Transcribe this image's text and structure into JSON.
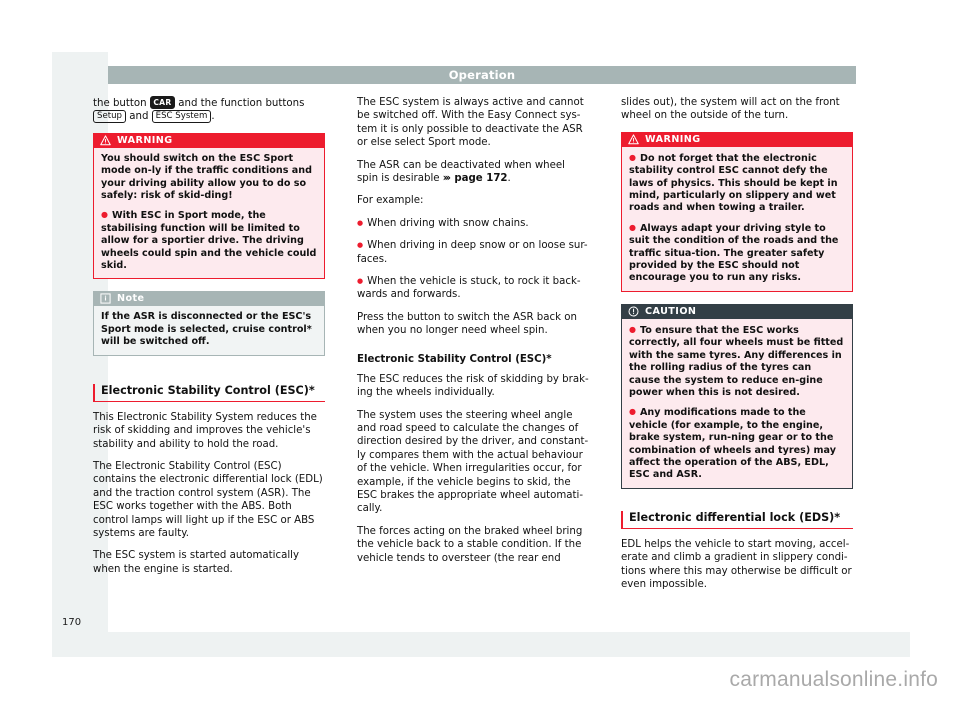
{
  "header": {
    "running_head": "Operation"
  },
  "folio": {
    "page_number": "170"
  },
  "watermark": {
    "text": "carmanualsonline.info"
  },
  "columns": {
    "left": {
      "intro": {
        "lead": "the button ",
        "key_car": "CAR",
        "mid": " and the function buttons ",
        "key_setup": "Setup",
        "and": " and ",
        "key_esc": "ESC System",
        "end": "."
      },
      "warning_box": {
        "title": "WARNING",
        "icon": "warning-triangle-icon",
        "paragraphs": [
          "You should switch on the ESC Sport mode on-ly if the traffic conditions and your driving ability allow you to do so safely: risk of skid-ding!",
          "With ESC in Sport mode, the stabilising function will be limited to allow for a sportier drive. The driving wheels could spin and the vehicle could skid."
        ]
      },
      "note_box": {
        "title": "Note",
        "icon": "info-square-icon",
        "paragraphs": [
          "If the ASR is disconnected or the ESC's Sport mode is selected, cruise control* will be switched off."
        ]
      },
      "section_title": "Electronic Stability Control (ESC)*",
      "paragraphs": [
        "This Electronic Stability System reduces the risk of skidding and improves the vehicle's stability and ability to hold the road.",
        "The Electronic Stability Control (ESC) contains the electronic differential lock (EDL) and the traction control system (ASR). The ESC works together with the ABS. Both control lamps will light up if the ESC or ABS systems are faulty.",
        "The ESC system is started automatically when the engine is started."
      ]
    },
    "middle": {
      "paragraphs_top": [
        "The ESC system is always active and cannot be switched off. With the Easy Connect sys-tem it is only possible to deactivate the ASR or else select Sport mode."
      ],
      "asr_line": {
        "before": "The ASR can be deactivated when wheel spin is desirable ",
        "chevron": "›››",
        "reference": " page 172",
        "after": "."
      },
      "for_example": "For example:",
      "bullets": [
        "When driving with snow chains.",
        "When driving in deep snow or on loose sur-faces.",
        "When the vehicle is stuck, to rock it back-wards and forwards."
      ],
      "press_button": "Press the button to switch the ASR back on when you no longer need wheel spin.",
      "subsection_title": "Electronic Stability Control (ESC)*",
      "paragraphs_bottom": [
        "The ESC reduces the risk of skidding by brak-ing the wheels individually.",
        "The system uses the steering wheel angle and road speed to calculate the changes of direction desired by the driver, and constant-ly compares them with the actual behaviour of the vehicle. When irregularities occur, for example, if the vehicle begins to skid, the ESC brakes the appropriate wheel automati-cally.",
        "The forces acting on the braked wheel bring the vehicle back to a stable condition. If the vehicle tends to oversteer (the rear end"
      ]
    },
    "right": {
      "continuation": "slides out), the system will act on the front wheel on the outside of the turn.",
      "warning_box": {
        "title": "WARNING",
        "icon": "warning-triangle-icon",
        "paragraphs": [
          "Do not forget that the electronic stability control ESC cannot defy the laws of physics. This should be kept in mind, particularly on slippery and wet roads and when towing a trailer.",
          "Always adapt your driving style to suit the condition of the roads and the traffic situa-tion. The greater safety provided by the ESC should not encourage you to run any risks."
        ]
      },
      "caution_box": {
        "title": "CAUTION",
        "icon": "exclamation-circle-icon",
        "paragraphs": [
          "To ensure that the ESC works correctly, all four wheels must be fitted with the same tyres. Any differences in the rolling radius of the tyres can cause the system to reduce en-gine power when this is not desired.",
          "Any modifications made to the vehicle (for example, to the engine, brake system, run-ning gear or to the combination of wheels and tyres) may affect the operation of the ABS, EDL, ESC and ASR."
        ]
      },
      "section_title": "Electronic differential lock (EDS)*",
      "paragraphs": [
        "EDL helps the vehicle to start moving, accel-erate and climb a gradient in slippery condi-tions where this may otherwise be difficult or even impossible."
      ]
    }
  },
  "colors": {
    "warning_red": "#ed1c2e",
    "note_gray": "#a7b5b5",
    "caution_dark": "#333f46",
    "page_bg": "#eef2f2"
  }
}
